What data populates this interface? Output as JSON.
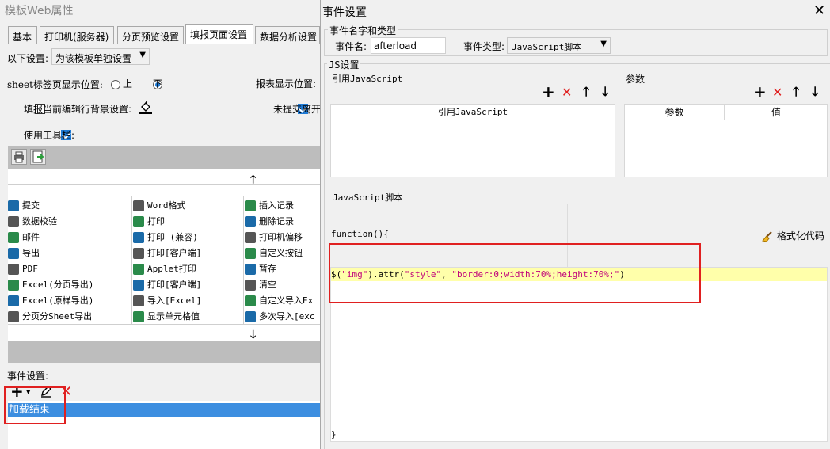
{
  "left_panel": {
    "title": "模板Web属性",
    "tabs": [
      "基本",
      "打印机(服务器)",
      "分页预览设置",
      "填报页面设置",
      "数据分析设置"
    ],
    "active_tab": 3,
    "settings_label": "以下设置:",
    "settings_value": "为该模板单独设置",
    "sheet_label": "sheet标签页显示位置:",
    "radio_top": "上",
    "radio_bottom": "下",
    "report_display_label": "报表显示位置:",
    "highlight_label": "填报当前编辑行背景设置:",
    "unsubmitted_label": "未提交离开",
    "use_toolbar_label": "使用工具栏:",
    "toolbar_items": [
      [
        "提交",
        "Word格式",
        "插入记录"
      ],
      [
        "数据校验",
        "打印",
        "删除记录"
      ],
      [
        "邮件",
        "打印 (兼容)",
        "打印机偏移"
      ],
      [
        "导出",
        "打印[客户端]",
        "自定义按钮"
      ],
      [
        "PDF",
        "Applet打印",
        "暂存"
      ],
      [
        "Excel(分页导出)",
        "打印[客户端]",
        "清空"
      ],
      [
        "Excel(原样导出)",
        "导入[Excel]",
        "自定义导入Ex"
      ],
      [
        "分页分Sheet导出",
        "显示单元格值",
        "多次导入[exc"
      ]
    ],
    "event_label": "事件设置:",
    "event_item": "加载结束"
  },
  "dialog": {
    "title": "事件设置",
    "group_name_type": "事件名字和类型",
    "event_name_label": "事件名:",
    "event_name_value": "afterload",
    "event_type_label": "事件类型:",
    "event_type_value": "JavaScript脚本",
    "js_group": "JS设置",
    "ref_js_label": "引用JavaScript",
    "ref_js_column": "引用JavaScript",
    "params_label": "参数",
    "params_columns": [
      "参数",
      "值"
    ],
    "script_label": "JavaScript脚本",
    "format_code_label": "格式化代码",
    "code_header": "function(){",
    "code_line_prefix": "$(",
    "code_str1": "\"img\"",
    "code_mid": ").attr(",
    "code_str2": "\"style\"",
    "code_comma": ", ",
    "code_str3": "\"border:0;width:70%;height:70%;\"",
    "code_end": ")",
    "code_footer": "}"
  }
}
